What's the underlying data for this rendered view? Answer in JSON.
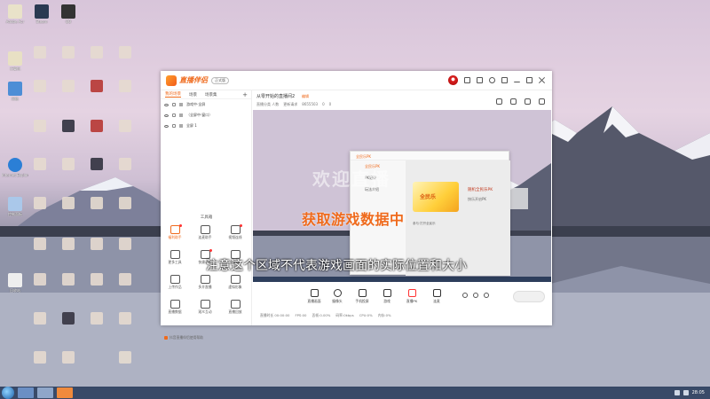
{
  "desktop": {
    "icons": [
      {
        "label": "Adobe Acr",
        "color": "#e9e2c9"
      },
      {
        "label": "计算机",
        "color": "#e8e0c4"
      },
      {
        "label": "Internet Explorer",
        "color": "#2b7fd6"
      },
      {
        "label": "网络",
        "color": "#5aa0e0"
      },
      {
        "label": "控制面板",
        "color": "#4d8ed6"
      },
      {
        "label": "回收站",
        "color": "#aac8ea"
      },
      {
        "label": "Steam",
        "color": "#2a3a52"
      },
      {
        "label": "QQ",
        "color": "#333"
      }
    ]
  },
  "taskbar": {
    "clock": "28:05"
  },
  "app": {
    "brand": "直播伴侣",
    "version_badge": "正式版",
    "scene_tabs": [
      "我的场景",
      "场景",
      "场景集"
    ],
    "add_scene": "+",
    "sources": [
      "游戏中·全屏",
      "（全屏中·窗口）",
      "全屏 1"
    ],
    "toolbox_title": "工具箱",
    "tools": [
      {
        "label": "福利助手",
        "orange": true,
        "dot": true
      },
      {
        "label": "连麦助手",
        "orange": false,
        "dot": false
      },
      {
        "label": "视频连线",
        "orange": false,
        "dot": true
      },
      {
        "label": "更多工具",
        "orange": false,
        "dot": false
      },
      {
        "label": "快捷录屏",
        "orange": false,
        "dot": true
      },
      {
        "label": "全屏PK",
        "orange": false,
        "dot": false
      },
      {
        "label": "上传作品",
        "orange": false,
        "dot": false
      },
      {
        "label": "多开直播",
        "orange": false,
        "dot": false
      },
      {
        "label": "虚拟形象",
        "orange": false,
        "dot": false
      },
      {
        "label": "直播数据",
        "orange": false,
        "dot": false
      },
      {
        "label": "观众互动",
        "orange": false,
        "dot": false
      },
      {
        "label": "直播回放",
        "orange": false,
        "dot": false
      }
    ],
    "bottom_note": "抖音直播伴侣使用帮助",
    "room": {
      "title": "从零开始的直播间2",
      "edit": "编辑",
      "meta": [
        "直播分类 人数",
        "更新请求",
        "8655503",
        "0",
        "0"
      ]
    },
    "popup": {
      "head": "全民乐PK",
      "side": [
        "全民乐PK",
        "PK记录",
        "玩法介绍"
      ],
      "game_thumb_label": "全民乐",
      "game_name": "随机全民乐PK",
      "game_sub": "快乐开启PK",
      "game_tag": "参与·打开全民乐"
    },
    "watermark": "欢迎直播",
    "loading_text": "获取游戏数据中",
    "caption": "注意这个区域不代表游戏画面的实际位置和大小",
    "controls": [
      {
        "label": "直播画面",
        "red": false
      },
      {
        "label": "摄像头",
        "red": false
      },
      {
        "label": "手机投屏",
        "red": false
      },
      {
        "label": "游戏",
        "red": false
      },
      {
        "label": "直播PK",
        "red": true
      },
      {
        "label": "连麦",
        "red": false
      }
    ],
    "stats": [
      "直播时长 00:00:00",
      "FPS:00",
      "丢帧:0.00%",
      "码率:0kbps",
      "CPU:0%",
      "内存:0%"
    ]
  }
}
